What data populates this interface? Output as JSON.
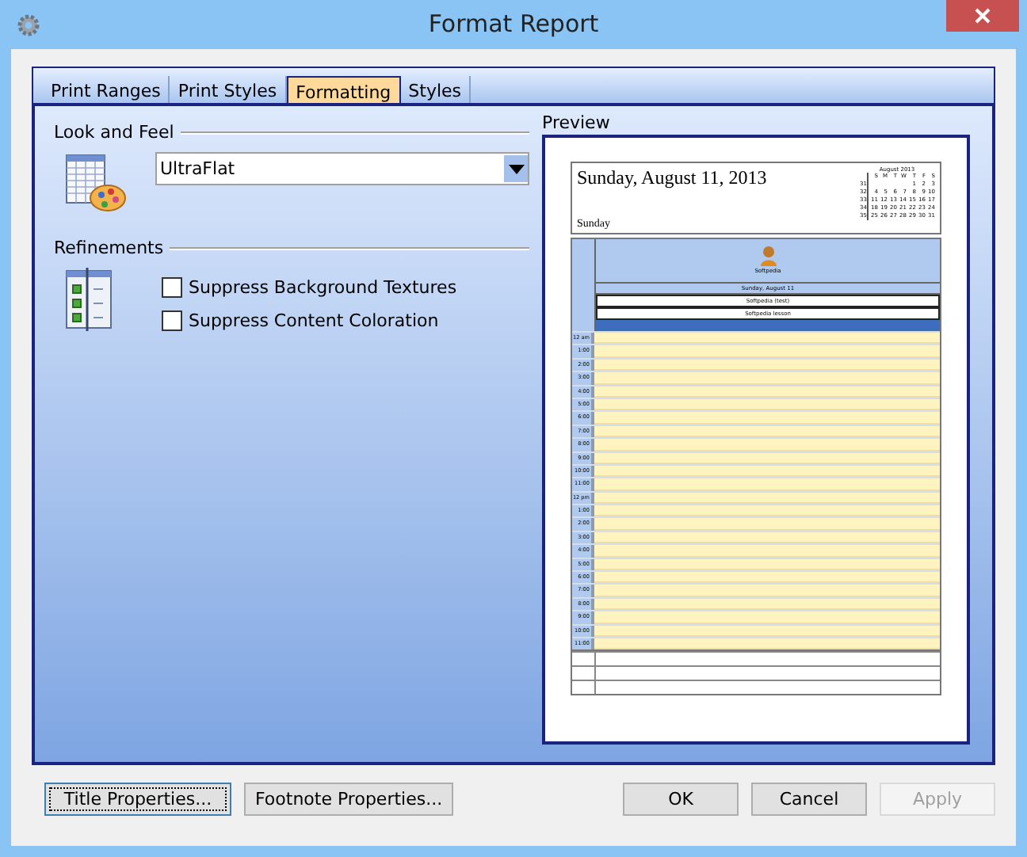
{
  "window": {
    "title": "Format Report"
  },
  "tabs": [
    {
      "label": "Print Ranges",
      "selected": false
    },
    {
      "label": "Print Styles",
      "selected": false
    },
    {
      "label": "Formatting",
      "selected": true
    },
    {
      "label": "Styles",
      "selected": false
    }
  ],
  "look_and_feel": {
    "heading": "Look and Feel",
    "dropdown": {
      "value": "UltraFlat"
    }
  },
  "refinements": {
    "heading": "Refinements",
    "options": [
      {
        "label": "Suppress Background Textures",
        "checked": false
      },
      {
        "label": "Suppress Content Coloration",
        "checked": false
      }
    ]
  },
  "preview": {
    "heading": "Preview",
    "date_title": "Sunday, August 11, 2013",
    "day_name": "Sunday",
    "mini_calendar": {
      "month": "August 2013",
      "weekdays": [
        "S",
        "M",
        "T",
        "W",
        "T",
        "F",
        "S"
      ],
      "weeks": [
        {
          "number": "31",
          "days": [
            "1",
            "2",
            "3"
          ]
        },
        {
          "number": "32",
          "days": [
            "4",
            "5",
            "6",
            "7",
            "8",
            "9",
            "10"
          ]
        },
        {
          "number": "33",
          "days": [
            "11",
            "12",
            "13",
            "14",
            "15",
            "16",
            "17"
          ]
        },
        {
          "number": "34",
          "days": [
            "18",
            "19",
            "20",
            "21",
            "22",
            "23",
            "24"
          ]
        },
        {
          "number": "35",
          "days": [
            "25",
            "26",
            "27",
            "28",
            "29",
            "30",
            "31"
          ]
        }
      ]
    },
    "resource_name": "Softpedia",
    "day_header": "Sunday, August 11",
    "all_day_events": [
      "Softpedia (test)",
      "Softpedia lesson"
    ],
    "hours": [
      "12 am",
      "1:00",
      "2:00",
      "3:00",
      "4:00",
      "5:00",
      "6:00",
      "7:00",
      "8:00",
      "9:00",
      "10:00",
      "11:00",
      "12 pm",
      "1:00",
      "2:00",
      "3:00",
      "4:00",
      "5:00",
      "6:00",
      "7:00",
      "8:00",
      "9:00",
      "10:00",
      "11:00"
    ]
  },
  "buttons": [
    {
      "label": "Title Properties...",
      "focused": true,
      "disabled": false
    },
    {
      "label": "Footnote Properties...",
      "focused": false,
      "disabled": false
    },
    {
      "label": "OK",
      "focused": false,
      "disabled": false
    },
    {
      "label": "Cancel",
      "focused": false,
      "disabled": false
    },
    {
      "label": "Apply",
      "focused": false,
      "disabled": true
    }
  ]
}
